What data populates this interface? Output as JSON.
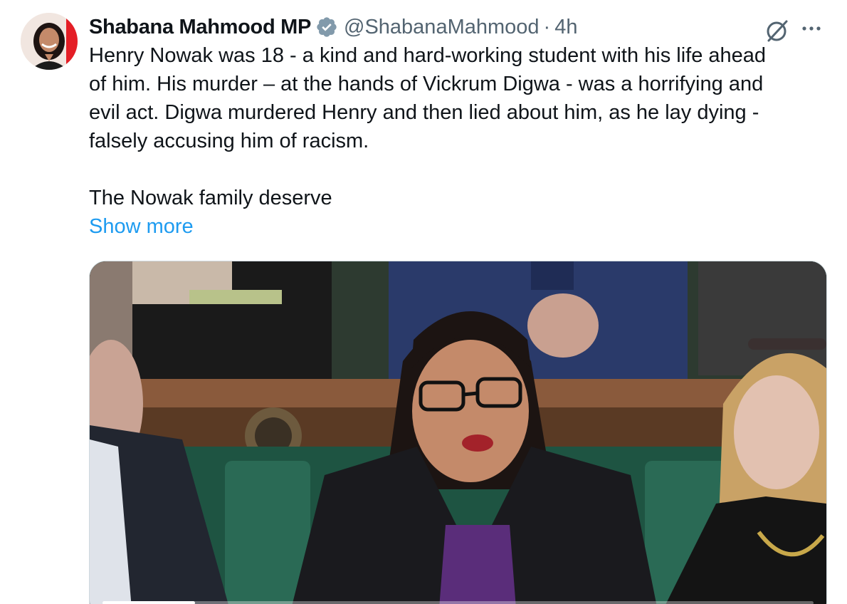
{
  "tweet": {
    "author_name": "Shabana Mahmood MP",
    "handle": "@ShabanaMahmood",
    "separator": "·",
    "time": "4h",
    "verified_icon": "verified-badge-icon",
    "grok_icon": "grok-icon",
    "more_icon": "more-options-icon",
    "paragraph_1": "Henry Nowak was 18 - a kind and hard-working student with his life ahead\nof him. His murder – at the hands of Vickrum Digwa - was a horrifying and\nevil act. Digwa murdered Henry and then lied about him, as he lay dying -\nfalsely accusing him of racism.",
    "paragraph_2": "The Nowak family deserve",
    "show_more": "Show more",
    "video_progress": 0.13
  },
  "colors": {
    "link": "#1d9bf0",
    "secondary_text": "#536471",
    "verified": "#829aab"
  }
}
